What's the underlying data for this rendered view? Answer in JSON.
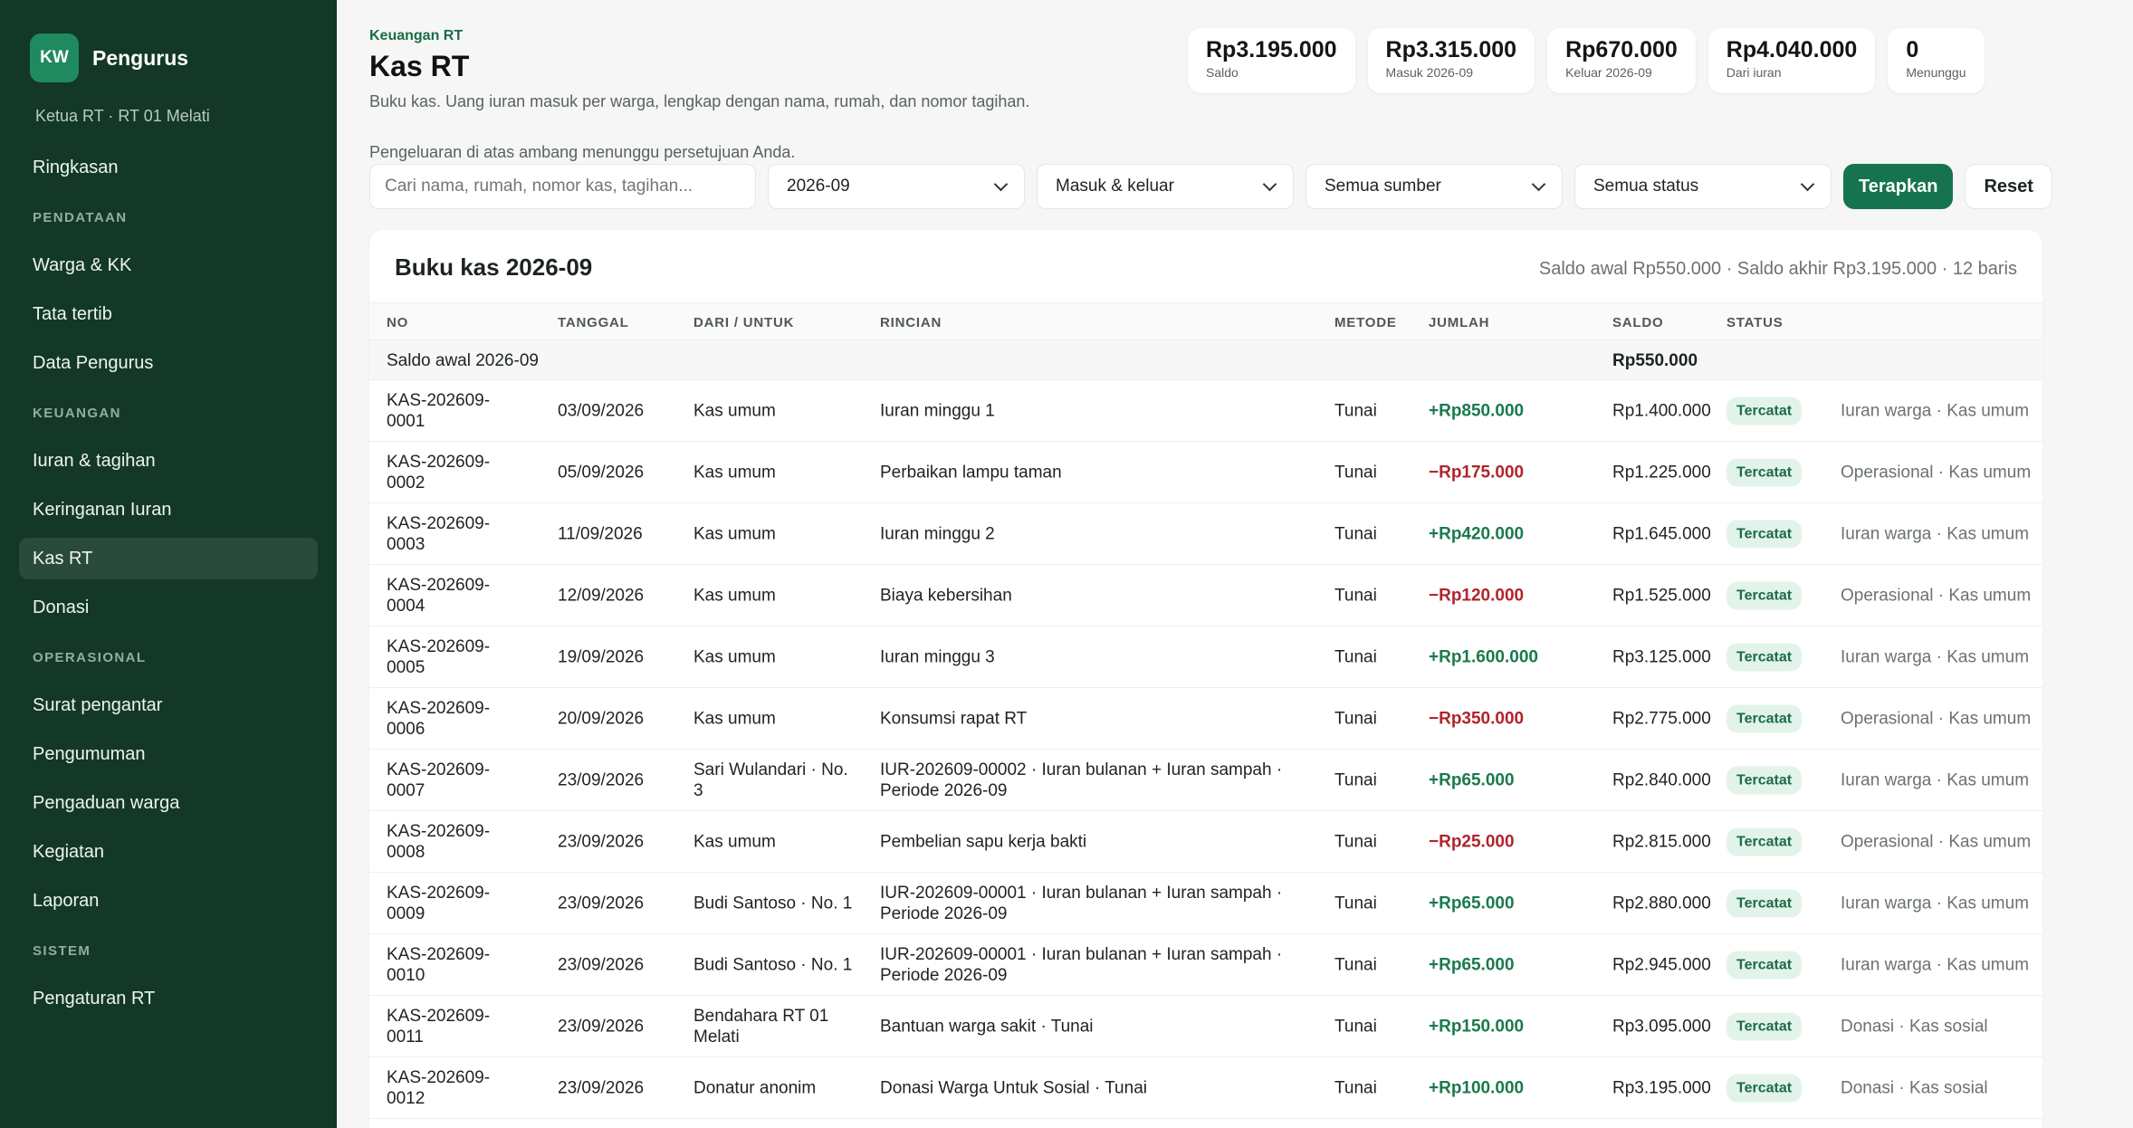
{
  "sidebar": {
    "logo": "KW",
    "brand": "Pengurus",
    "role": "Ketua RT · RT 01 Melati",
    "items": [
      {
        "type": "item",
        "label": "Ringkasan",
        "active": false
      },
      {
        "type": "section",
        "label": "PENDATAAN"
      },
      {
        "type": "item",
        "label": "Warga & KK",
        "active": false
      },
      {
        "type": "item",
        "label": "Tata tertib",
        "active": false
      },
      {
        "type": "item",
        "label": "Data Pengurus",
        "active": false
      },
      {
        "type": "section",
        "label": "KEUANGAN"
      },
      {
        "type": "item",
        "label": "Iuran & tagihan",
        "active": false
      },
      {
        "type": "item",
        "label": "Keringanan Iuran",
        "active": false
      },
      {
        "type": "item",
        "label": "Kas RT",
        "active": true
      },
      {
        "type": "item",
        "label": "Donasi",
        "active": false
      },
      {
        "type": "section",
        "label": "OPERASIONAL"
      },
      {
        "type": "item",
        "label": "Surat pengantar",
        "active": false
      },
      {
        "type": "item",
        "label": "Pengumuman",
        "active": false
      },
      {
        "type": "item",
        "label": "Pengaduan warga",
        "active": false
      },
      {
        "type": "item",
        "label": "Kegiatan",
        "active": false
      },
      {
        "type": "item",
        "label": "Laporan",
        "active": false
      },
      {
        "type": "section",
        "label": "SISTEM"
      },
      {
        "type": "item",
        "label": "Pengaturan RT",
        "active": false
      }
    ]
  },
  "header": {
    "breadcrumb": "Keuangan RT",
    "title": "Kas RT",
    "description": "Buku kas. Uang iuran masuk per warga, lengkap dengan nama, rumah, dan nomor tagihan.",
    "note": "Pengeluaran di atas ambang menunggu persetujuan Anda."
  },
  "stats": [
    {
      "value": "Rp3.195.000",
      "label": "Saldo"
    },
    {
      "value": "Rp3.315.000",
      "label": "Masuk 2026-09"
    },
    {
      "value": "Rp670.000",
      "label": "Keluar 2026-09"
    },
    {
      "value": "Rp4.040.000",
      "label": "Dari iuran"
    },
    {
      "value": "0",
      "label": "Menunggu"
    }
  ],
  "filters": {
    "search_placeholder": "Cari nama, rumah, nomor kas, tagihan...",
    "period": "2026-09",
    "direction": "Masuk & keluar",
    "source": "Semua sumber",
    "status": "Semua status",
    "apply_label": "Terapkan",
    "reset_label": "Reset"
  },
  "ledger": {
    "title": "Buku kas 2026-09",
    "meta": "Saldo awal Rp550.000 · Saldo akhir Rp3.195.000 · 12 baris",
    "columns": [
      "NO",
      "TANGGAL",
      "DARI / UNTUK",
      "RINCIAN",
      "METODE",
      "JUMLAH",
      "SALDO",
      "STATUS"
    ],
    "opening_label": "Saldo awal 2026-09",
    "opening_value": "Rp550.000",
    "rows": [
      {
        "no": "KAS-202609-0001",
        "date": "03/09/2026",
        "from": "Kas umum",
        "detail": "Iuran minggu 1",
        "method": "Tunai",
        "amount": "+Rp850.000",
        "dir": "in",
        "balance": "Rp1.400.000",
        "status": "Tercatat",
        "category": "Iuran warga · Kas umum"
      },
      {
        "no": "KAS-202609-0002",
        "date": "05/09/2026",
        "from": "Kas umum",
        "detail": "Perbaikan lampu taman",
        "method": "Tunai",
        "amount": "−Rp175.000",
        "dir": "out",
        "balance": "Rp1.225.000",
        "status": "Tercatat",
        "category": "Operasional · Kas umum"
      },
      {
        "no": "KAS-202609-0003",
        "date": "11/09/2026",
        "from": "Kas umum",
        "detail": "Iuran minggu 2",
        "method": "Tunai",
        "amount": "+Rp420.000",
        "dir": "in",
        "balance": "Rp1.645.000",
        "status": "Tercatat",
        "category": "Iuran warga · Kas umum"
      },
      {
        "no": "KAS-202609-0004",
        "date": "12/09/2026",
        "from": "Kas umum",
        "detail": "Biaya kebersihan",
        "method": "Tunai",
        "amount": "−Rp120.000",
        "dir": "out",
        "balance": "Rp1.525.000",
        "status": "Tercatat",
        "category": "Operasional · Kas umum"
      },
      {
        "no": "KAS-202609-0005",
        "date": "19/09/2026",
        "from": "Kas umum",
        "detail": "Iuran minggu 3",
        "method": "Tunai",
        "amount": "+Rp1.600.000",
        "dir": "in",
        "balance": "Rp3.125.000",
        "status": "Tercatat",
        "category": "Iuran warga · Kas umum"
      },
      {
        "no": "KAS-202609-0006",
        "date": "20/09/2026",
        "from": "Kas umum",
        "detail": "Konsumsi rapat RT",
        "method": "Tunai",
        "amount": "−Rp350.000",
        "dir": "out",
        "balance": "Rp2.775.000",
        "status": "Tercatat",
        "category": "Operasional · Kas umum"
      },
      {
        "no": "KAS-202609-0007",
        "date": "23/09/2026",
        "from": "Sari Wulandari · No. 3",
        "detail": "IUR-202609-00002 · Iuran bulanan + Iuran sampah · Periode 2026-09",
        "method": "Tunai",
        "amount": "+Rp65.000",
        "dir": "in",
        "balance": "Rp2.840.000",
        "status": "Tercatat",
        "category": "Iuran warga · Kas umum"
      },
      {
        "no": "KAS-202609-0008",
        "date": "23/09/2026",
        "from": "Kas umum",
        "detail": "Pembelian sapu kerja bakti",
        "method": "Tunai",
        "amount": "−Rp25.000",
        "dir": "out",
        "balance": "Rp2.815.000",
        "status": "Tercatat",
        "category": "Operasional · Kas umum"
      },
      {
        "no": "KAS-202609-0009",
        "date": "23/09/2026",
        "from": "Budi Santoso · No. 1",
        "detail": "IUR-202609-00001 · Iuran bulanan + Iuran sampah · Periode 2026-09",
        "method": "Tunai",
        "amount": "+Rp65.000",
        "dir": "in",
        "balance": "Rp2.880.000",
        "status": "Tercatat",
        "category": "Iuran warga · Kas umum"
      },
      {
        "no": "KAS-202609-0010",
        "date": "23/09/2026",
        "from": "Budi Santoso · No. 1",
        "detail": "IUR-202609-00001 · Iuran bulanan + Iuran sampah · Periode 2026-09",
        "method": "Tunai",
        "amount": "+Rp65.000",
        "dir": "in",
        "balance": "Rp2.945.000",
        "status": "Tercatat",
        "category": "Iuran warga · Kas umum"
      },
      {
        "no": "KAS-202609-0011",
        "date": "23/09/2026",
        "from": "Bendahara RT 01 Melati",
        "detail": "Bantuan warga sakit · Tunai",
        "method": "Tunai",
        "amount": "+Rp150.000",
        "dir": "in",
        "balance": "Rp3.095.000",
        "status": "Tercatat",
        "category": "Donasi · Kas sosial"
      },
      {
        "no": "KAS-202609-0012",
        "date": "23/09/2026",
        "from": "Donatur anonim",
        "detail": "Donasi Warga Untuk Sosial · Tunai",
        "method": "Tunai",
        "amount": "+Rp100.000",
        "dir": "in",
        "balance": "Rp3.195.000",
        "status": "Tercatat",
        "category": "Donasi · Kas sosial"
      }
    ]
  }
}
